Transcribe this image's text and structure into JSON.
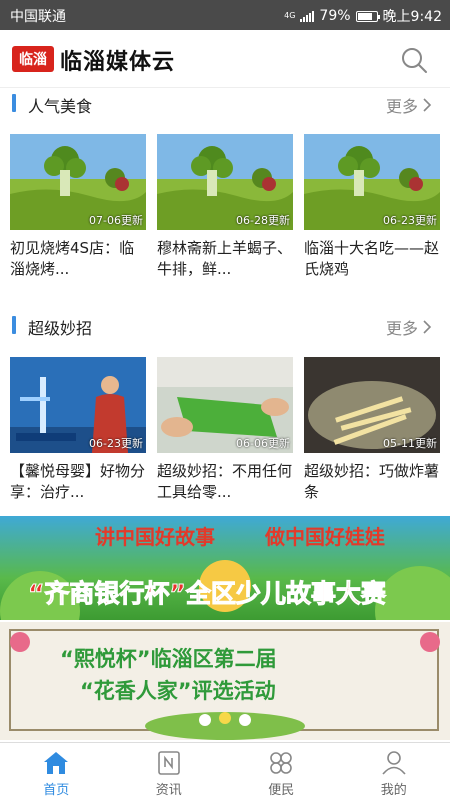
{
  "status": {
    "carrier": "中国联通",
    "network": "4G",
    "battery": "79%",
    "time": "晚上9:42"
  },
  "header": {
    "logo_text": "临淄",
    "title": "临淄媒体云"
  },
  "sections": [
    {
      "title": "人气美食",
      "more": "更多",
      "items": [
        {
          "date": "07-06更新",
          "caption": "初见烧烤4S店：临淄烧烤..."
        },
        {
          "date": "06-28更新",
          "caption": "穆林斋新上羊蝎子、牛排，鲜..."
        },
        {
          "date": "06-23更新",
          "caption": "临淄十大名吃——赵氏烧鸡"
        }
      ]
    },
    {
      "title": "超级妙招",
      "more": "更多",
      "items": [
        {
          "date": "06-23更新",
          "caption": "【馨悦母婴】好物分享：治疗..."
        },
        {
          "date": "06-06更新",
          "caption": "超级妙招：不用任何工具给零..."
        },
        {
          "date": "05-11更新",
          "caption": "超级妙招：巧做炸薯条"
        }
      ]
    }
  ],
  "banners": {
    "b1": {
      "line1_left": "讲中国好故事",
      "line1_right": "做中国好娃娃",
      "line2": "“齐商银行杯”全区少儿故事大赛"
    },
    "b2": {
      "line1": "“熙悦杯”临淄区第二届",
      "line2": "“花香人家”评选活动"
    }
  },
  "tabs": [
    {
      "label": "首页",
      "icon": "home-icon"
    },
    {
      "label": "资讯",
      "icon": "news-icon"
    },
    {
      "label": "便民",
      "icon": "services-icon"
    },
    {
      "label": "我的",
      "icon": "profile-icon"
    }
  ],
  "colors": {
    "accent": "#2f8be0",
    "logo_red": "#d8241c"
  }
}
